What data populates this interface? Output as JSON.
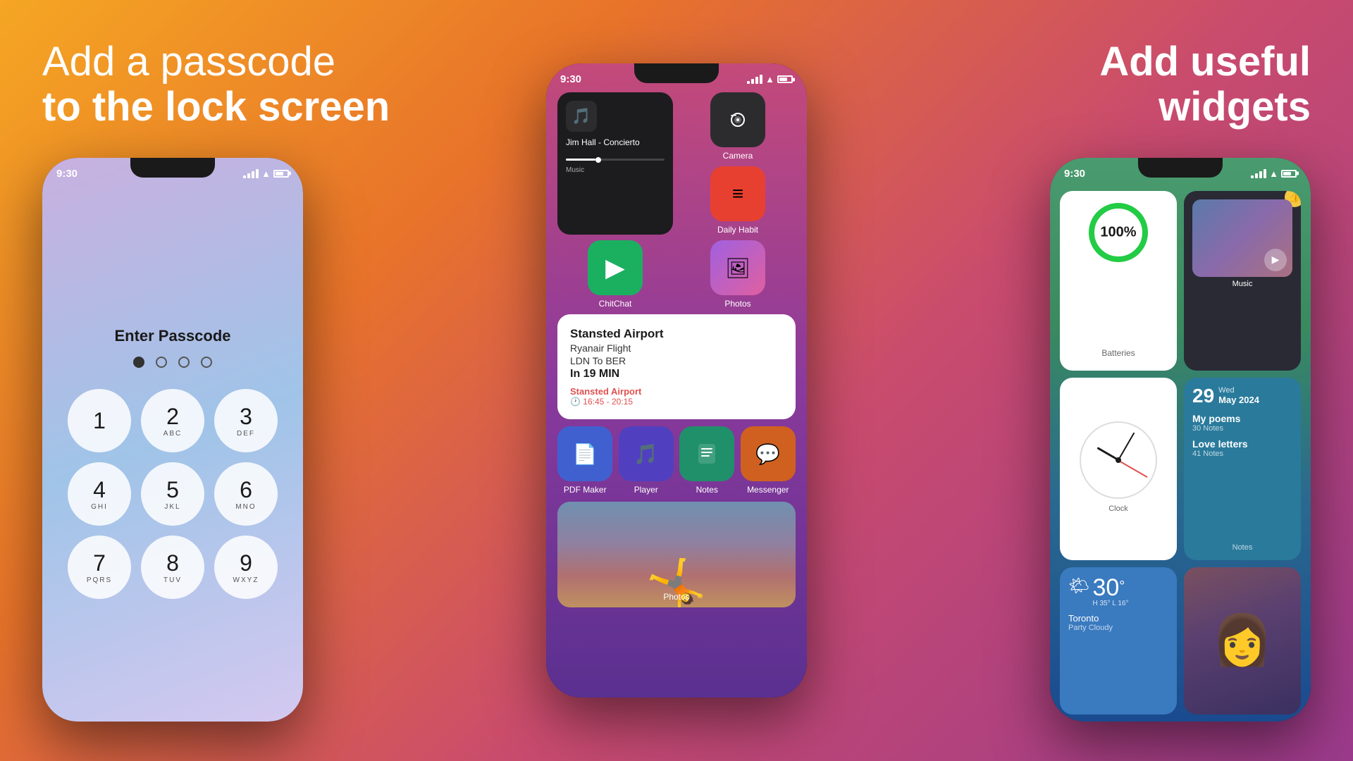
{
  "left": {
    "title_line1": "Add a passcode",
    "title_line2": "to the lock screen",
    "phone": {
      "time": "9:30",
      "passcode_label": "Enter Passcode",
      "dots": [
        true,
        false,
        false,
        false
      ],
      "numpad": [
        {
          "main": "1",
          "sub": ""
        },
        {
          "main": "2",
          "sub": "ABC"
        },
        {
          "main": "3",
          "sub": "DEF"
        },
        {
          "main": "4",
          "sub": "GHI"
        },
        {
          "main": "5",
          "sub": "JKL"
        },
        {
          "main": "6",
          "sub": "MNO"
        },
        {
          "main": "7",
          "sub": "PQRS"
        },
        {
          "main": "8",
          "sub": "TUV"
        },
        {
          "main": "9",
          "sub": "WXYZ"
        }
      ]
    }
  },
  "center": {
    "phone": {
      "time": "9:30",
      "apps_row1": [
        {
          "label": "Music",
          "icon": "🎵",
          "bg": "#2a2a2a"
        },
        {
          "label": "Camera",
          "icon": "📷",
          "bg": "#2a2a2a"
        },
        {
          "label": "Daily Habit",
          "icon": "≡",
          "bg": "#e85040"
        }
      ],
      "apps_row2": [
        {
          "label": "Music",
          "icon": "♫"
        },
        {
          "label": "ChitChat",
          "icon": "💬",
          "bg": "#1ab060"
        },
        {
          "label": "Photos",
          "icon": "🖼️",
          "bg": "#9060d0"
        }
      ],
      "music_track": "Jim Hall - Concierto",
      "flight": {
        "airport": "Stansted Airport",
        "flight": "Ryanair Flight",
        "route": "LDN To BER",
        "eta": "In 19 MIN",
        "link": "Stansted Airport",
        "schedule": "🕐 16:45 - 20:15"
      },
      "bottom_apps": [
        {
          "label": "PDF Maker",
          "icon": "📄",
          "bg": "#5070e0"
        },
        {
          "label": "Player",
          "icon": "🎵",
          "bg": "#5050d0"
        },
        {
          "label": "Notes",
          "icon": "📋",
          "bg": "#30a070"
        },
        {
          "label": "Messenger",
          "icon": "💬",
          "bg": "#e07030"
        }
      ],
      "photos_label": "Photos"
    }
  },
  "right": {
    "title_line1": "Add useful",
    "title_line2": "widgets",
    "phone": {
      "time": "9:30",
      "batteries_label": "Batteries",
      "battery_pct": "100%",
      "music_label": "Music",
      "clock_label": "Clock",
      "notes": {
        "label": "Notes",
        "day": "29",
        "weekday": "Wed",
        "month_year": "May 2024",
        "entries": [
          {
            "title": "My poems",
            "count": "30 Notes"
          },
          {
            "title": "Love letters",
            "count": "41 Notes"
          }
        ]
      },
      "weather": {
        "temp": "30",
        "degree": "°",
        "hi": "H 35°",
        "lo": "L 16°",
        "city": "Toronto",
        "condition": "Party Cloudy"
      }
    }
  }
}
